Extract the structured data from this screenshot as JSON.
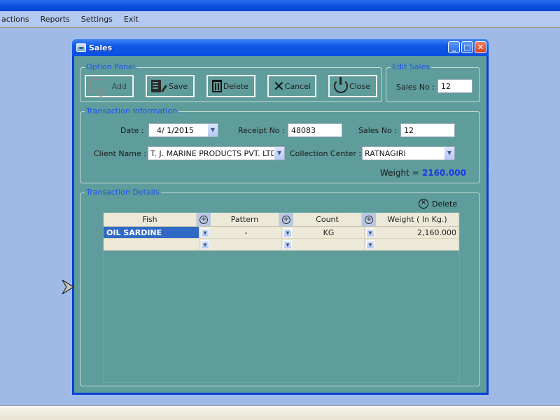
{
  "menubar": {
    "items": [
      "actions",
      "Reports",
      "Settings",
      "Exit"
    ]
  },
  "window": {
    "title": "Sales",
    "controls": {
      "minimize": "_",
      "maximize": "□",
      "close": "✕"
    }
  },
  "option_panel": {
    "legend": "Option Panel",
    "buttons": {
      "add": "Add",
      "save": "Save",
      "delete": "Delete",
      "cancel": "Cancel",
      "close": "Close"
    }
  },
  "edit_sales": {
    "legend": "Edit Sales",
    "sales_no_label": "Sales No :",
    "sales_no_value": "12"
  },
  "transaction_info": {
    "legend": "Transaction Information",
    "date_label": "Date :",
    "date_value": "4/ 1/2015",
    "receipt_label": "Receipt No :",
    "receipt_value": "48083",
    "sales_no_label": "Sales No :",
    "sales_no_value": "12",
    "client_label": "Client Name :",
    "client_value": "T. J. MARINE PRODUCTS PVT. LTD.",
    "center_label": "Collection Center :",
    "center_value": "RATNAGIRI",
    "weight_label": "Weight =",
    "weight_value": "2160.000"
  },
  "transaction_details": {
    "legend": "Transaction Details",
    "delete_label": "Delete",
    "columns": [
      "Fish",
      "Pattern",
      "Count",
      "Weight ( In Kg.)"
    ],
    "rows": [
      {
        "fish": "OIL SARDINE",
        "pattern": "-",
        "count": "KG",
        "weight": "2,160.000"
      },
      {
        "fish": "",
        "pattern": "",
        "count": "",
        "weight": ""
      }
    ]
  },
  "colors": {
    "form_bg": "#5f9c9c",
    "legend_blue": "#1e56e8",
    "weight_blue": "#1a3ae8",
    "selection": "#316ac5",
    "desktop": "#a0bae8"
  }
}
